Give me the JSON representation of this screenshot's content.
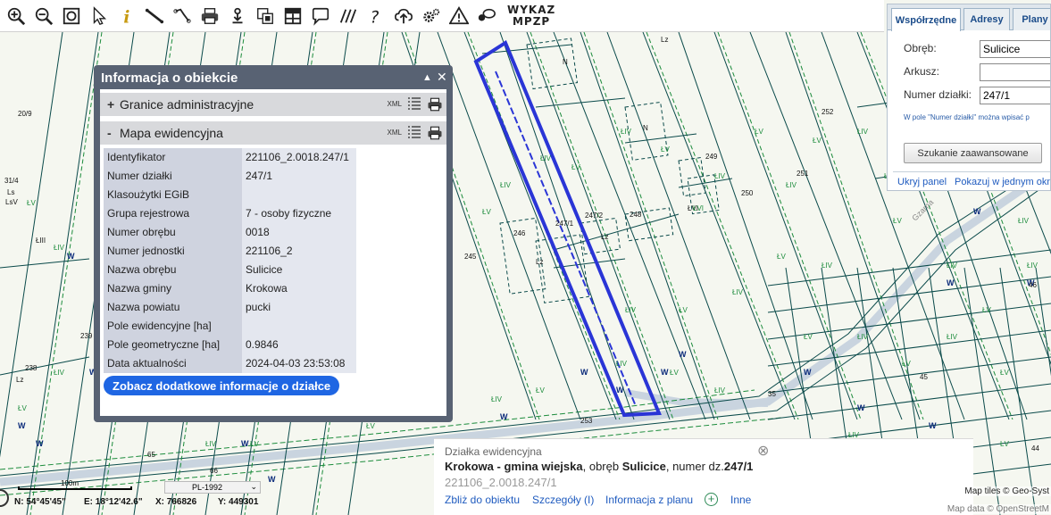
{
  "toolbar": {
    "wykaz_line1": "WYKAZ",
    "wykaz_line2": "MPZP",
    "buttons": [
      "zoom-in-icon",
      "zoom-out-icon",
      "zoom-extent-icon",
      "select-arrow-icon",
      "info-icon",
      "measure-ruler-icon",
      "measure-chain-icon",
      "print-icon",
      "pan-hand-icon",
      "layers-icon",
      "layout-icon",
      "chat-icon",
      "hatch-icon",
      "help-icon",
      "upload-cloud-icon",
      "settings-gears-icon",
      "warning-icon",
      "comment-icon"
    ]
  },
  "info_panel": {
    "title": "Informacja o obiekcie",
    "sections": [
      {
        "sign": "+",
        "label": "Granice administracyjne",
        "xml": "XML"
      },
      {
        "sign": "-",
        "label": "Mapa ewidencyjna",
        "xml": "XML"
      }
    ],
    "attributes": [
      {
        "key": "Identyfikator",
        "value": "221106_2.0018.247/1"
      },
      {
        "key": "Numer działki",
        "value": "247/1"
      },
      {
        "key": "Klasoużytki EGiB",
        "value": ""
      },
      {
        "key": "Grupa rejestrowa",
        "value": "7 - osoby fizyczne"
      },
      {
        "key": "Numer obrębu",
        "value": "0018"
      },
      {
        "key": "Numer jednostki",
        "value": "221106_2"
      },
      {
        "key": "Nazwa obrębu",
        "value": "Sulicice"
      },
      {
        "key": "Nazwa gminy",
        "value": "Krokowa"
      },
      {
        "key": "Nazwa powiatu",
        "value": "pucki"
      },
      {
        "key": "Pole ewidencyjne [ha]",
        "value": ""
      },
      {
        "key": "Pole geometryczne [ha]",
        "value": "0.9846"
      },
      {
        "key": "Data aktualności",
        "value": "2024-04-03 23:53:08"
      }
    ],
    "more_button": "Zobacz dodatkowe informacje o działce"
  },
  "right_panel": {
    "tabs": [
      "Współrzędne",
      "Adresy",
      "Plany"
    ],
    "active_tab": "Współrzędne",
    "fields": [
      {
        "label": "Obręb:",
        "value": "Sulicice"
      },
      {
        "label": "Arkusz:",
        "value": ""
      },
      {
        "label": "Numer działki:",
        "value": "247/1"
      }
    ],
    "hint": "W pole \"Numer działki\" można wpisać p",
    "search_button": "Szukanie zaawansowane",
    "link_hide": "Ukryj panel",
    "link_show": "Pokazuj w jednym okn"
  },
  "popup": {
    "type": "Działka ewidencyjna",
    "gmina": "Krokowa - gmina wiejska",
    "sep1": ", obręb ",
    "obreb": "Sulicice",
    "sep2": ", numer dz.",
    "numer": "247/1",
    "id": "221106_2.0018.247/1",
    "links": [
      "Zbliż do obiektu",
      "Szczegóły (I)",
      "Informacja z planu",
      "Inne"
    ],
    "plus": "+",
    "close": "⊗"
  },
  "bottom": {
    "scale_label": "100m",
    "crs": "PL-1992",
    "coord_n": "N: 54°45'45\"",
    "coord_e": "E: 18°12'42.6\"",
    "coord_x": "X: 766826",
    "coord_y": "Y: 449301",
    "attribution_1": "Map tiles © Geo-Syst",
    "attribution_2": "Map data © OpenStreetM"
  },
  "map": {
    "parcel_labels": [
      "20/9",
      "31/4",
      "Ls",
      "LsV",
      "Ł",
      "ŁIII",
      "239",
      "238",
      "Lz",
      "245",
      "246",
      "247/1",
      "247/2",
      "248",
      "249",
      "ŁVI",
      "250",
      "251",
      "252",
      "253",
      "35",
      "45",
      "46",
      "65",
      "66",
      "44",
      "N",
      "ŁIV",
      "ŁV",
      "Lz",
      "Gzarna"
    ],
    "colors": {
      "parcel_lines": "#0a4a4a",
      "boundary_green": "#1c8c3c",
      "highlight": "#2a35d6",
      "class_label": "#2aa02a",
      "road": "#c9d4df"
    }
  }
}
